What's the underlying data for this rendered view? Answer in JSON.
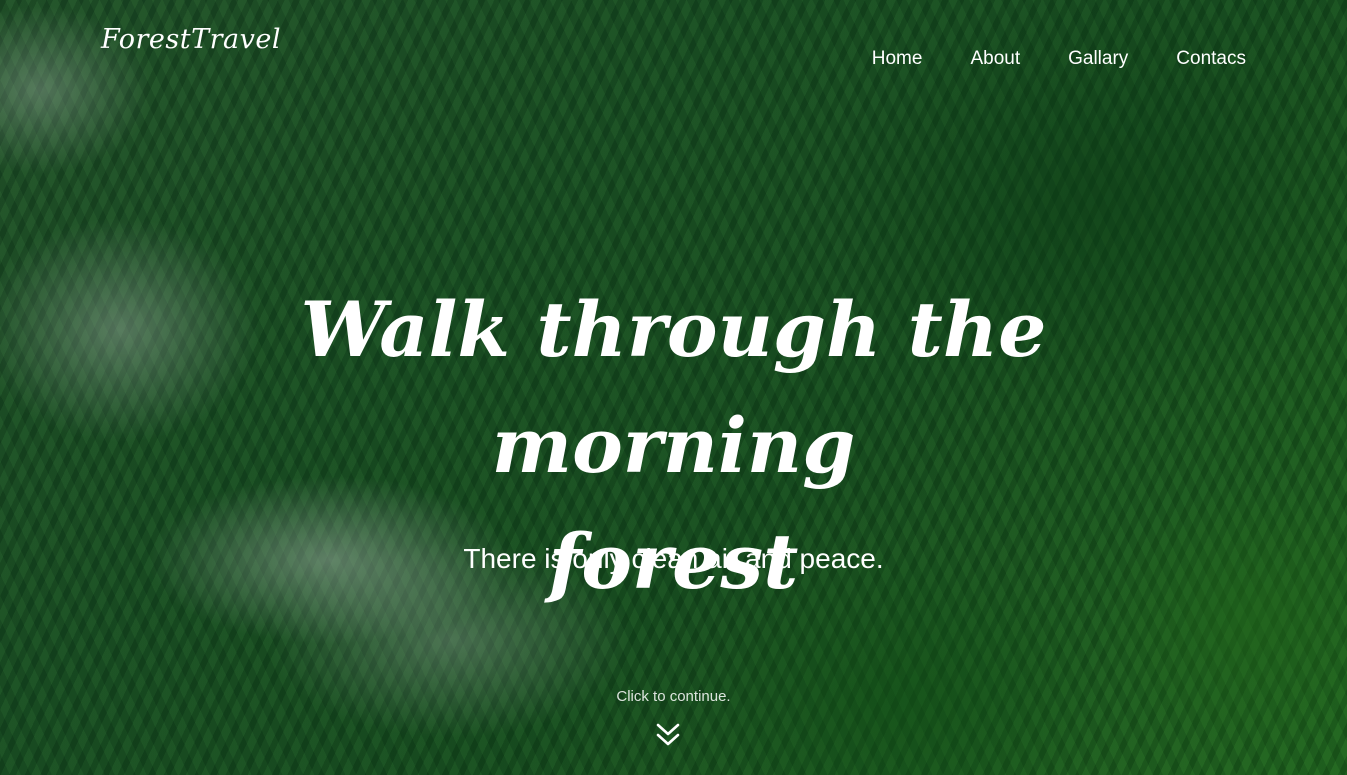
{
  "header": {
    "logo_text": "ForestTravel",
    "nav": [
      {
        "label": "Home"
      },
      {
        "label": "About"
      },
      {
        "label": "Gallary"
      },
      {
        "label": "Contacs"
      }
    ]
  },
  "hero": {
    "headline_line1": "Walk through the morning",
    "headline_line2": "forest",
    "subtitle": "There is only clean air and peace.",
    "continue_text": "Click to continue.",
    "continue_icon": "double-chevron-down-icon",
    "background": "forest-with-fog-photo"
  },
  "colors": {
    "text": "#ffffff",
    "forest_dark": "#1f5a2a",
    "forest_light": "#2a7a25"
  }
}
